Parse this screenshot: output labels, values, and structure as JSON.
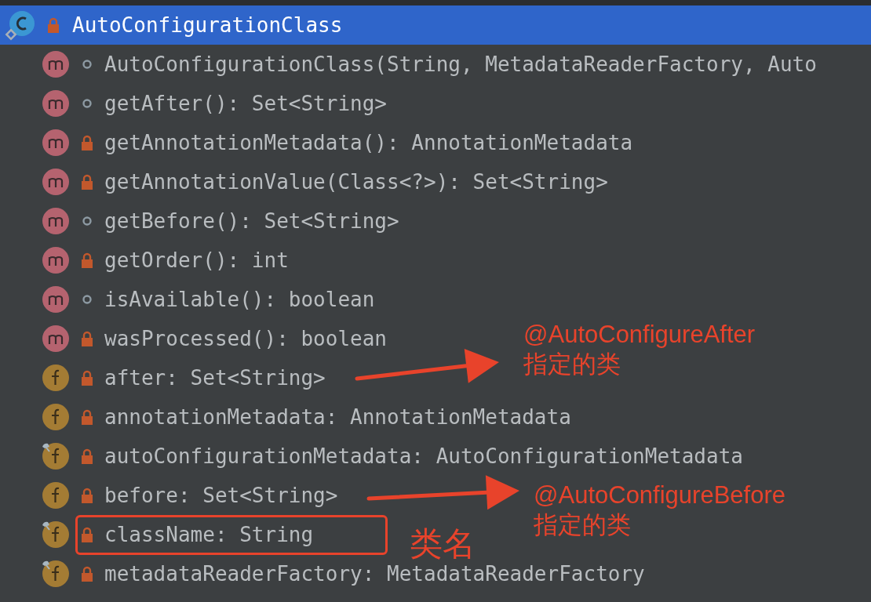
{
  "header": {
    "title": "AutoConfigurationClass",
    "locked": true
  },
  "members": [
    {
      "kind": "method",
      "locked": false,
      "final": false,
      "highlighted": false,
      "signature": "AutoConfigurationClass(String, MetadataReaderFactory, Auto"
    },
    {
      "kind": "method",
      "locked": false,
      "final": false,
      "highlighted": false,
      "signature": "getAfter(): Set<String>"
    },
    {
      "kind": "method",
      "locked": true,
      "final": false,
      "highlighted": false,
      "signature": "getAnnotationMetadata(): AnnotationMetadata"
    },
    {
      "kind": "method",
      "locked": true,
      "final": false,
      "highlighted": false,
      "signature": "getAnnotationValue(Class<?>): Set<String>"
    },
    {
      "kind": "method",
      "locked": false,
      "final": false,
      "highlighted": false,
      "signature": "getBefore(): Set<String>"
    },
    {
      "kind": "method",
      "locked": true,
      "final": false,
      "highlighted": false,
      "signature": "getOrder(): int"
    },
    {
      "kind": "method",
      "locked": false,
      "final": false,
      "highlighted": false,
      "signature": "isAvailable(): boolean"
    },
    {
      "kind": "method",
      "locked": true,
      "final": false,
      "highlighted": false,
      "signature": "wasProcessed(): boolean"
    },
    {
      "kind": "field",
      "locked": true,
      "final": false,
      "highlighted": false,
      "signature": "after: Set<String>"
    },
    {
      "kind": "field",
      "locked": true,
      "final": false,
      "highlighted": false,
      "signature": "annotationMetadata: AnnotationMetadata"
    },
    {
      "kind": "field",
      "locked": true,
      "final": true,
      "highlighted": false,
      "signature": "autoConfigurationMetadata: AutoConfigurationMetadata"
    },
    {
      "kind": "field",
      "locked": true,
      "final": false,
      "highlighted": false,
      "signature": "before: Set<String>"
    },
    {
      "kind": "field",
      "locked": true,
      "final": true,
      "highlighted": true,
      "signature": "className: String"
    },
    {
      "kind": "field",
      "locked": true,
      "final": true,
      "highlighted": false,
      "signature": "metadataReaderFactory: MetadataReaderFactory"
    }
  ],
  "annotations": [
    {
      "lines": [
        "@AutoConfigureAfter",
        "指定的类"
      ]
    },
    {
      "lines": [
        "@AutoConfigureBefore",
        "指定的类"
      ]
    },
    {
      "lines": [
        "类名"
      ]
    }
  ]
}
